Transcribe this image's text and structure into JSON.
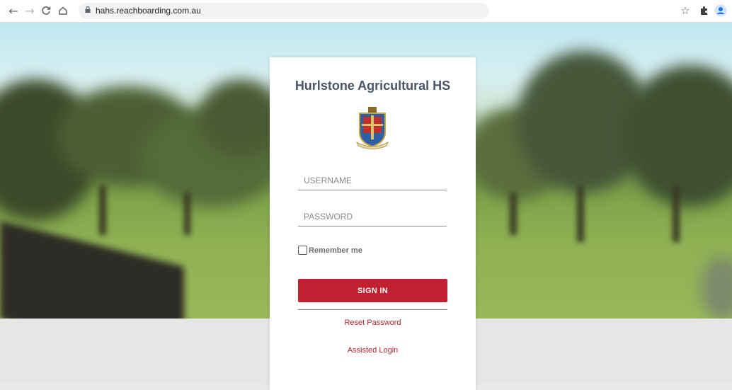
{
  "browser": {
    "url": "hahs.reachboarding.com.au",
    "icons": [
      "back-icon",
      "forward-icon",
      "reload-icon",
      "home-icon",
      "lock-icon",
      "star-icon",
      "extensions-icon",
      "profile-icon"
    ]
  },
  "login": {
    "title": "Hurlstone Agricultural HS",
    "username_placeholder": "USERNAME",
    "password_placeholder": "PASSWORD",
    "remember_label": "Remember me",
    "remember_checked": false,
    "signin_label": "SIGN IN",
    "reset_link": "Reset Password",
    "assisted_link": "Assisted Login"
  },
  "colors": {
    "accent": "#c0202f",
    "link": "#b2232f",
    "title": "#4a5568"
  }
}
